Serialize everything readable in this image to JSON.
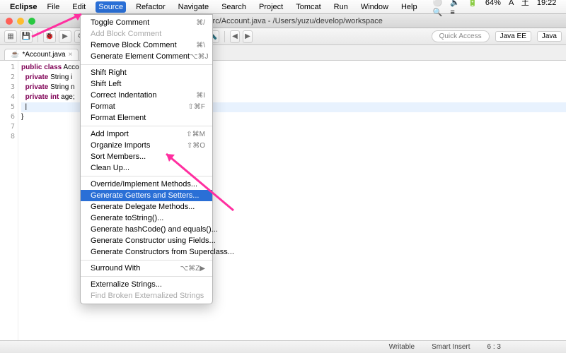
{
  "mac_menu": {
    "app": "Eclipse",
    "items": [
      "File",
      "Edit",
      "Source",
      "Refactor",
      "Navigate",
      "Search",
      "Project",
      "Tomcat",
      "Run",
      "Window",
      "Help"
    ],
    "open_index": 2,
    "status": {
      "battery": "64%",
      "day": "土",
      "time": "19:22",
      "ime": "A"
    }
  },
  "window": {
    "title": "ratorTest/src/Account.java - /Users/yuzu/develop/workspace"
  },
  "toolbar": {
    "quick_access": "Quick Access",
    "persp1": "Java EE",
    "persp2": "Java"
  },
  "editor": {
    "tab_label": "*Account.java",
    "line_numbers": [
      "1",
      "2",
      "3",
      "4",
      "5",
      "6",
      "7",
      "8"
    ],
    "code_lines": [
      {
        "pre": "",
        "kw": "public class",
        "post": " Acco"
      },
      {
        "pre": "  ",
        "kw": "private",
        "post": " String i"
      },
      {
        "pre": "  ",
        "kw": "private",
        "post": " String n"
      },
      {
        "pre": "  ",
        "kw": "private int",
        "post": " age;"
      },
      {
        "pre": "  ",
        "kw": "",
        "post": "|",
        "cursor": true
      },
      {
        "pre": "}",
        "kw": "",
        "post": ""
      },
      {
        "pre": "",
        "kw": "",
        "post": ""
      },
      {
        "pre": "",
        "kw": "",
        "post": ""
      }
    ]
  },
  "menu": {
    "groups": [
      [
        {
          "label": "Toggle Comment",
          "shortcut": "⌘/"
        },
        {
          "label": "Add Block Comment",
          "shortcut": "",
          "disabled": true
        },
        {
          "label": "Remove Block Comment",
          "shortcut": "⌘\\",
          "disabled": false
        },
        {
          "label": "Generate Element Comment",
          "shortcut": "⌥⌘J"
        }
      ],
      [
        {
          "label": "Shift Right"
        },
        {
          "label": "Shift Left"
        },
        {
          "label": "Correct Indentation",
          "shortcut": "⌘I"
        },
        {
          "label": "Format",
          "shortcut": "⇧⌘F"
        },
        {
          "label": "Format Element"
        }
      ],
      [
        {
          "label": "Add Import",
          "shortcut": "⇧⌘M"
        },
        {
          "label": "Organize Imports",
          "shortcut": "⇧⌘O"
        },
        {
          "label": "Sort Members..."
        },
        {
          "label": "Clean Up..."
        }
      ],
      [
        {
          "label": "Override/Implement Methods..."
        },
        {
          "label": "Generate Getters and Setters...",
          "highlight": true
        },
        {
          "label": "Generate Delegate Methods..."
        },
        {
          "label": "Generate toString()..."
        },
        {
          "label": "Generate hashCode() and equals()..."
        },
        {
          "label": "Generate Constructor using Fields..."
        },
        {
          "label": "Generate Constructors from Superclass..."
        }
      ],
      [
        {
          "label": "Surround With",
          "shortcut": "⌥⌘Z",
          "submenu": true
        }
      ],
      [
        {
          "label": "Externalize Strings..."
        },
        {
          "label": "Find Broken Externalized Strings",
          "disabled": true
        }
      ]
    ]
  },
  "status": {
    "writable": "Writable",
    "insert": "Smart Insert",
    "pos": "6 : 3"
  }
}
